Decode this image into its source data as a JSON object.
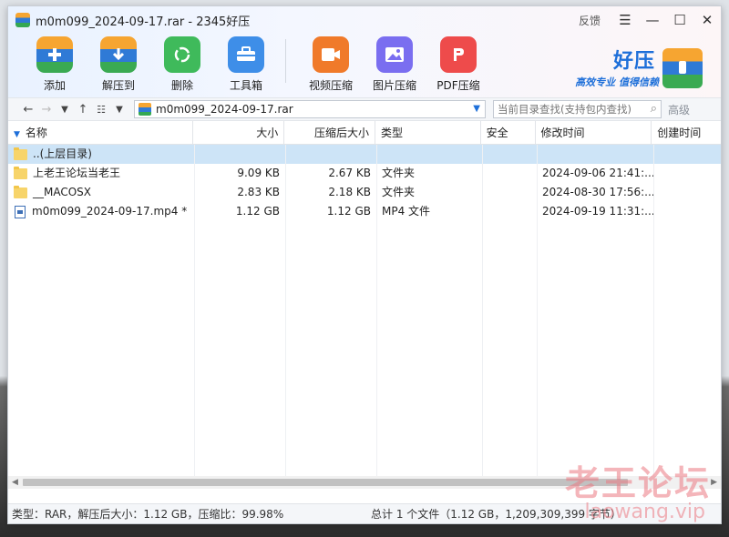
{
  "window": {
    "title": "m0m099_2024-09-17.rar - 2345好压",
    "feedback": "反馈",
    "menu_glyph": "☰",
    "minimize_glyph": "—",
    "maximize_glyph": "☐",
    "close_glyph": "✕"
  },
  "toolbar": {
    "add": "添加",
    "extract": "解压到",
    "delete": "删除",
    "tools": "工具箱",
    "video_compress": "视频压缩",
    "image_compress": "图片压缩",
    "pdf_compress": "PDF压缩"
  },
  "brand": {
    "name": "好压",
    "slogan": "高效专业 值得信赖"
  },
  "address": {
    "path": "m0m099_2024-09-17.rar",
    "search_placeholder": "当前目录查找(支持包内查找)",
    "advanced": "高级"
  },
  "columns": {
    "name": "名称",
    "size": "大小",
    "packed": "压缩后大小",
    "type": "类型",
    "security": "安全",
    "modified": "修改时间",
    "created": "创建时间"
  },
  "rows": [
    {
      "name": "..(上层目录)",
      "size": "",
      "packed": "",
      "type": "",
      "modified": ""
    },
    {
      "name": "上老王论坛当老王",
      "size": "9.09 KB",
      "packed": "2.67 KB",
      "type": "文件夹",
      "modified": "2024-09-06 21:41:..."
    },
    {
      "name": "__MACOSX",
      "size": "2.83 KB",
      "packed": "2.18 KB",
      "type": "文件夹",
      "modified": "2024-08-30 17:56:..."
    },
    {
      "name": "m0m099_2024-09-17.mp4 *",
      "size": "1.12 GB",
      "packed": "1.12 GB",
      "type": "MP4 文件",
      "modified": "2024-09-19 11:31:..."
    }
  ],
  "status": {
    "left": "类型：RAR，解压后大小：1.12 GB，压缩比：99.98%",
    "right": "总计 1 个文件（1.12 GB，1,209,309,399 字节）"
  },
  "watermark": {
    "cn": "老王论坛",
    "en": "laowang.vip"
  },
  "colors": {
    "accent": "#1e6fd9",
    "selection": "#cde4f7"
  }
}
